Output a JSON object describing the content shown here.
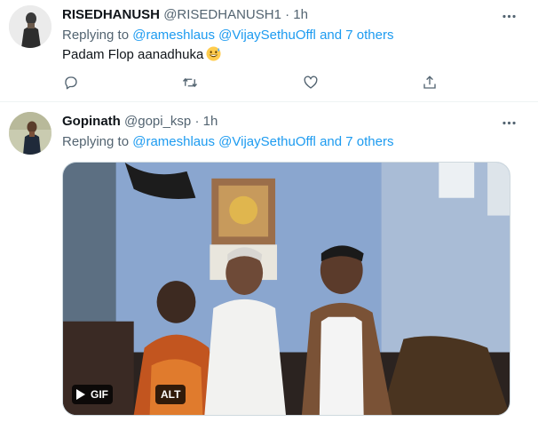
{
  "tweets": [
    {
      "display_name": "RISEDHANUSH",
      "handle": "@RISEDHANUSH1",
      "separator": "·",
      "time": "1h",
      "replying_prefix": "Replying to",
      "replying_users": "@rameshlaus @VijaySethuOffl",
      "replying_suffix": "and 7 others",
      "text": "Padam Flop aanadhuka",
      "emoji": "grinning-face-with-sweat"
    },
    {
      "display_name": "Gopinath",
      "handle": "@gopi_ksp",
      "separator": "·",
      "time": "1h",
      "replying_prefix": "Replying to",
      "replying_users": "@rameshlaus @VijaySethuOffl",
      "replying_suffix": "and 7 others",
      "media": {
        "type": "gif",
        "gif_label": "GIF",
        "alt_label": "ALT"
      }
    }
  ],
  "icons": {
    "more": "more-horizontal-icon",
    "reply": "reply-icon",
    "retweet": "retweet-icon",
    "like": "like-heart-icon",
    "share": "share-icon",
    "play": "play-icon"
  },
  "colors": {
    "link": "#1d9bf0",
    "secondary_text": "#536471",
    "primary_text": "#0f1419",
    "divider": "#eff3f4"
  }
}
